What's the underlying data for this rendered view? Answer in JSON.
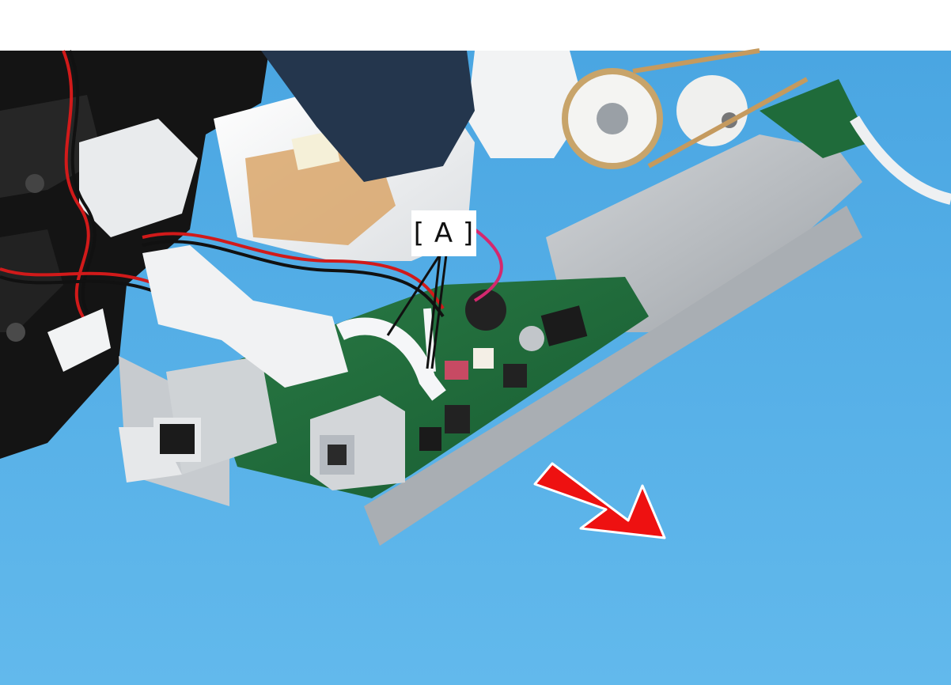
{
  "photo": {
    "subject": "printer-interior-main-board",
    "colors": {
      "background_blue": "#5eb4e8",
      "board_green": "#1f6b3a",
      "arrow_red": "#ee1111",
      "frame_gray": "#b8bcc0"
    }
  },
  "callout": {
    "label": "[ A ]"
  },
  "direction_arrow": {
    "icon": "red-arrow-icon"
  }
}
